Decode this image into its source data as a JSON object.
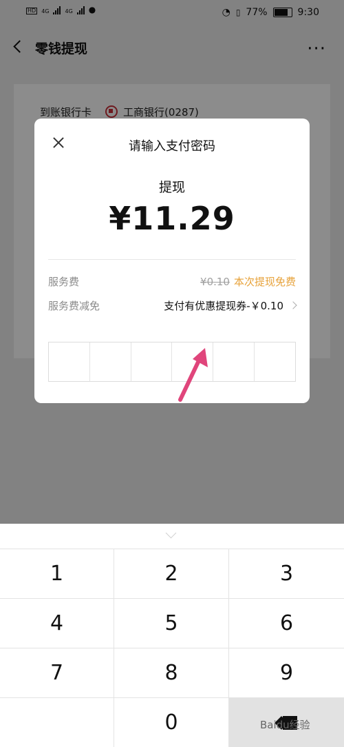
{
  "status_bar": {
    "battery": "77%",
    "time": "9:30",
    "network_left": "4G",
    "network_right": "4G",
    "hd": "HD"
  },
  "header": {
    "title": "零钱提现",
    "more": "···"
  },
  "background_card": {
    "label": "到账银行卡",
    "bank": "工商银行(0287)"
  },
  "dialog": {
    "title": "请输入支付密码",
    "operation": "提现",
    "amount": "¥11.29",
    "fee_label": "服务费",
    "fee_original": "¥0.10",
    "fee_note": "本次提现免费",
    "reduction_label": "服务费减免",
    "reduction_value": "支付有优惠提现券-￥0.10"
  },
  "keypad": {
    "keys": [
      "1",
      "2",
      "3",
      "4",
      "5",
      "6",
      "7",
      "8",
      "9",
      "",
      "0",
      ""
    ]
  },
  "watermark": "Baidu经验",
  "colors": {
    "accent_orange": "#e7a23a",
    "arrow_pink": "#e0457b",
    "overlay": "rgba(0,0,0,0.45)"
  }
}
